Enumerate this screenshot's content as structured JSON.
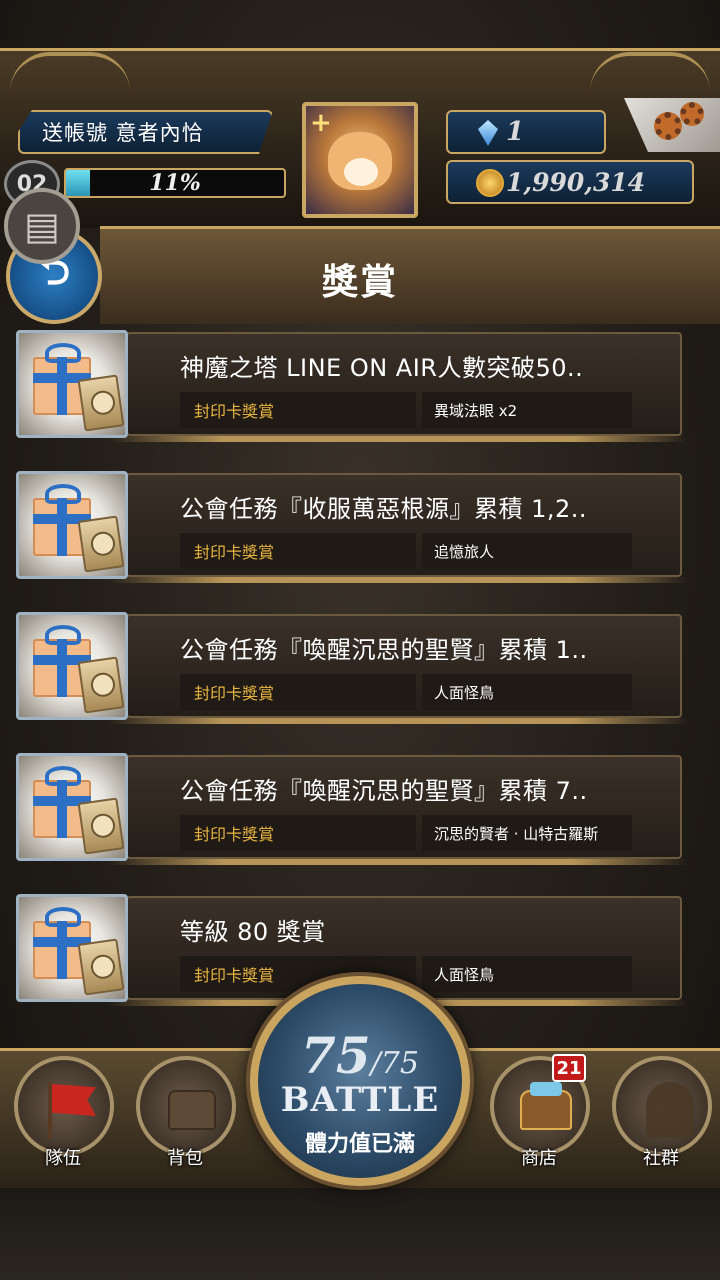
{
  "hud": {
    "player_name": "送帳號 意者內恰",
    "level": "02",
    "exp_percent_label": "11%",
    "exp_fraction": 0.11,
    "gems": "1",
    "coins": "1,990,314"
  },
  "header": {
    "title": "獎賞",
    "back_icon": "⮌",
    "menu_icon": "▤"
  },
  "rewards": [
    {
      "title": "神魔之塔 LINE ON AIR人數突破50..",
      "type": "封印卡獎賞",
      "desc": "異域法眼 x2"
    },
    {
      "title": "公會任務『收服萬惡根源』累積 1,2..",
      "type": "封印卡獎賞",
      "desc": "追憶旅人"
    },
    {
      "title": "公會任務『喚醒沉思的聖賢』累積 1..",
      "type": "封印卡獎賞",
      "desc": "人面怪鳥"
    },
    {
      "title": "公會任務『喚醒沉思的聖賢』累積 7..",
      "type": "封印卡獎賞",
      "desc": "沉思的賢者 · 山特古羅斯"
    },
    {
      "title": "等級 80 獎賞",
      "type": "封印卡獎賞",
      "desc": "人面怪鳥"
    }
  ],
  "nav": {
    "team": "隊伍",
    "bag": "背包",
    "shop": "商店",
    "social": "社群",
    "shop_badge": "21"
  },
  "battle": {
    "stamina_current": "75",
    "stamina_sep": "/",
    "stamina_max": "75",
    "label": "BATTLE",
    "status": "體力值已滿"
  }
}
